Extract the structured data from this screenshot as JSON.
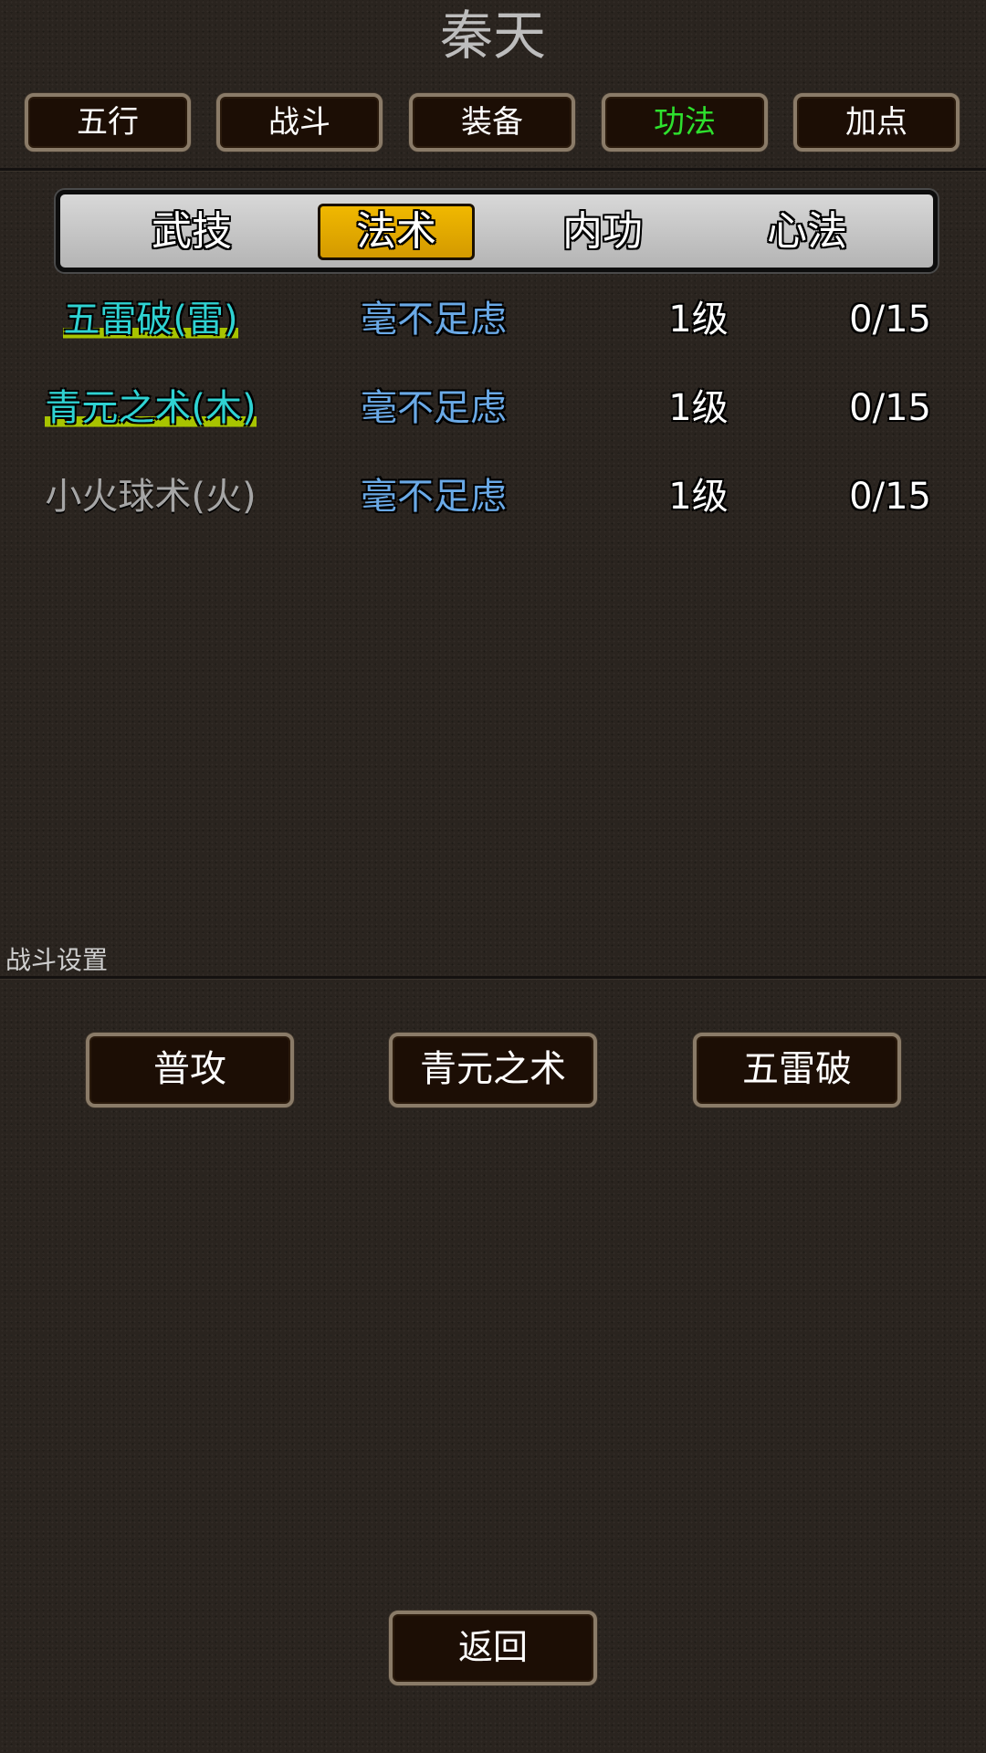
{
  "title": "秦天",
  "top_tabs": [
    {
      "label": "五行",
      "active": false
    },
    {
      "label": "战斗",
      "active": false
    },
    {
      "label": "装备",
      "active": false
    },
    {
      "label": "功法",
      "active": true
    },
    {
      "label": "加点",
      "active": false
    }
  ],
  "sub_tabs": [
    {
      "label": "武技",
      "active": false
    },
    {
      "label": "法术",
      "active": true
    },
    {
      "label": "内功",
      "active": false
    },
    {
      "label": "心法",
      "active": false
    }
  ],
  "skills": [
    {
      "name": "五雷破(雷)",
      "grade": "毫不足虑",
      "level": "1级",
      "exp": "0/15",
      "equipped": true
    },
    {
      "name": "青元之术(木)",
      "grade": "毫不足虑",
      "level": "1级",
      "exp": "0/15",
      "equipped": true
    },
    {
      "name": "小火球术(火)",
      "grade": "毫不足虑",
      "level": "1级",
      "exp": "0/15",
      "equipped": false
    }
  ],
  "battle_settings": {
    "label": "战斗设置",
    "slots": [
      "普攻",
      "青元之术",
      "五雷破"
    ]
  },
  "back_label": "返回",
  "colors": {
    "active_tab_text": "#2ee02e",
    "skill_name": "#2fd2d2",
    "skill_grade": "#6aa9e6",
    "subtab_active_bg": "#e0a800"
  }
}
